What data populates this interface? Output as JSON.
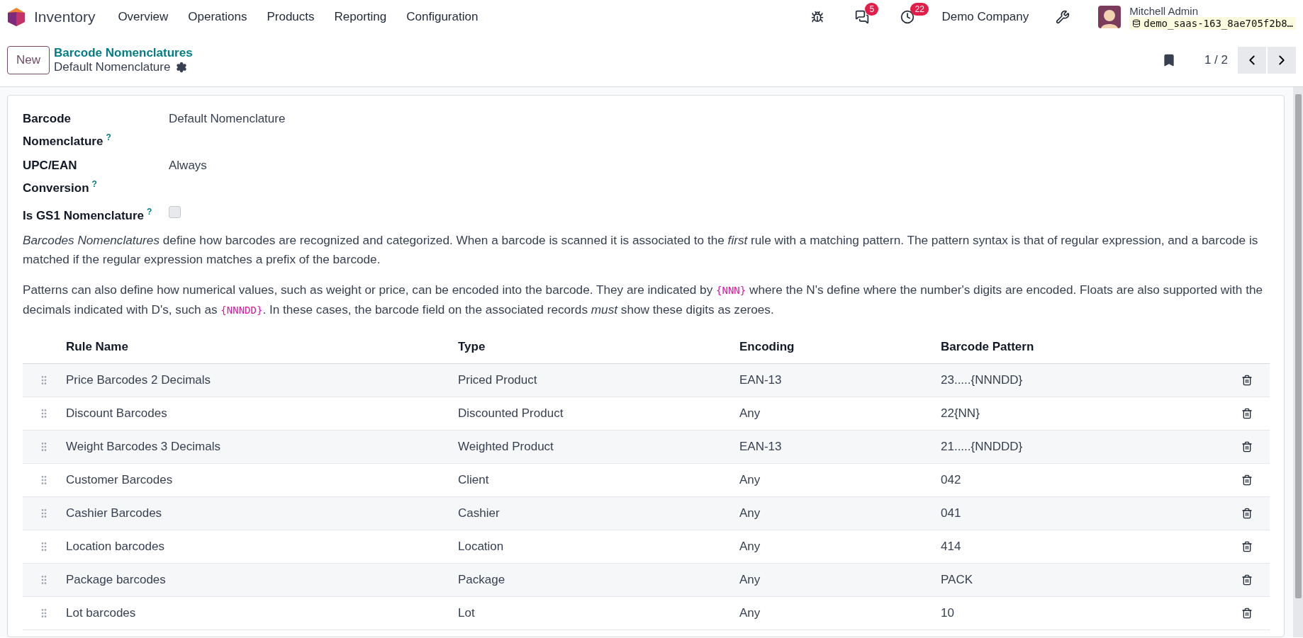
{
  "navbar": {
    "app_name": "Inventory",
    "menu": [
      "Overview",
      "Operations",
      "Products",
      "Reporting",
      "Configuration"
    ],
    "messages_count": "5",
    "activities_count": "22",
    "company": "Demo Company",
    "user_name": "Mitchell Admin",
    "database": "demo_saas-163_8ae705f2b8…"
  },
  "control_panel": {
    "new_button": "New",
    "breadcrumb": "Barcode Nomenclatures",
    "title": "Default Nomenclature",
    "pager": "1 / 2"
  },
  "fields": [
    {
      "kind": "text",
      "label": "Barcode Nomenclature",
      "help": "?",
      "value": "Default Nomenclature"
    },
    {
      "kind": "text",
      "label": "UPC/EAN Conversion",
      "help": "?",
      "value": "Always"
    },
    {
      "kind": "checkbox",
      "label": "Is GS1 Nomenclature",
      "help": "?",
      "checked": false
    }
  ],
  "paragraphs": [
    [
      {
        "kind": "italic",
        "text": "Barcodes Nomenclatures"
      },
      {
        "kind": "plain",
        "text": " define how barcodes are recognized and categorized. When a barcode is scanned it is associated to the "
      },
      {
        "kind": "italic",
        "text": "first"
      },
      {
        "kind": "plain",
        "text": " rule with a matching pattern. The pattern syntax is that of regular expression, and a barcode is matched if the regular expression matches a prefix of the barcode."
      }
    ],
    [
      {
        "kind": "plain",
        "text": "Patterns can also define how numerical values, such as weight or price, can be encoded into the barcode. They are indicated by "
      },
      {
        "kind": "code",
        "text": "{NNN}"
      },
      {
        "kind": "plain",
        "text": " where the N's define where the number's digits are encoded. Floats are also supported with the decimals indicated with D's, such as "
      },
      {
        "kind": "code",
        "text": "{NNNDD}"
      },
      {
        "kind": "plain",
        "text": ". In these cases, the barcode field on the associated records "
      },
      {
        "kind": "italic",
        "text": "must"
      },
      {
        "kind": "plain",
        "text": " show these digits as zeroes."
      }
    ]
  ],
  "table": {
    "columns": [
      "Rule Name",
      "Type",
      "Encoding",
      "Barcode Pattern"
    ],
    "rows": [
      {
        "name": "Price Barcodes 2 Decimals",
        "type": "Priced Product",
        "encoding": "EAN-13",
        "pattern": "23.....{NNNDD}"
      },
      {
        "name": "Discount Barcodes",
        "type": "Discounted Product",
        "encoding": "Any",
        "pattern": "22{NN}"
      },
      {
        "name": "Weight Barcodes 3 Decimals",
        "type": "Weighted Product",
        "encoding": "EAN-13",
        "pattern": "21.....{NNDDD}"
      },
      {
        "name": "Customer Barcodes",
        "type": "Client",
        "encoding": "Any",
        "pattern": "042"
      },
      {
        "name": "Cashier Barcodes",
        "type": "Cashier",
        "encoding": "Any",
        "pattern": "041"
      },
      {
        "name": "Location barcodes",
        "type": "Location",
        "encoding": "Any",
        "pattern": "414"
      },
      {
        "name": "Package barcodes",
        "type": "Package",
        "encoding": "Any",
        "pattern": "PACK"
      },
      {
        "name": "Lot barcodes",
        "type": "Lot",
        "encoding": "Any",
        "pattern": "10"
      }
    ]
  }
}
